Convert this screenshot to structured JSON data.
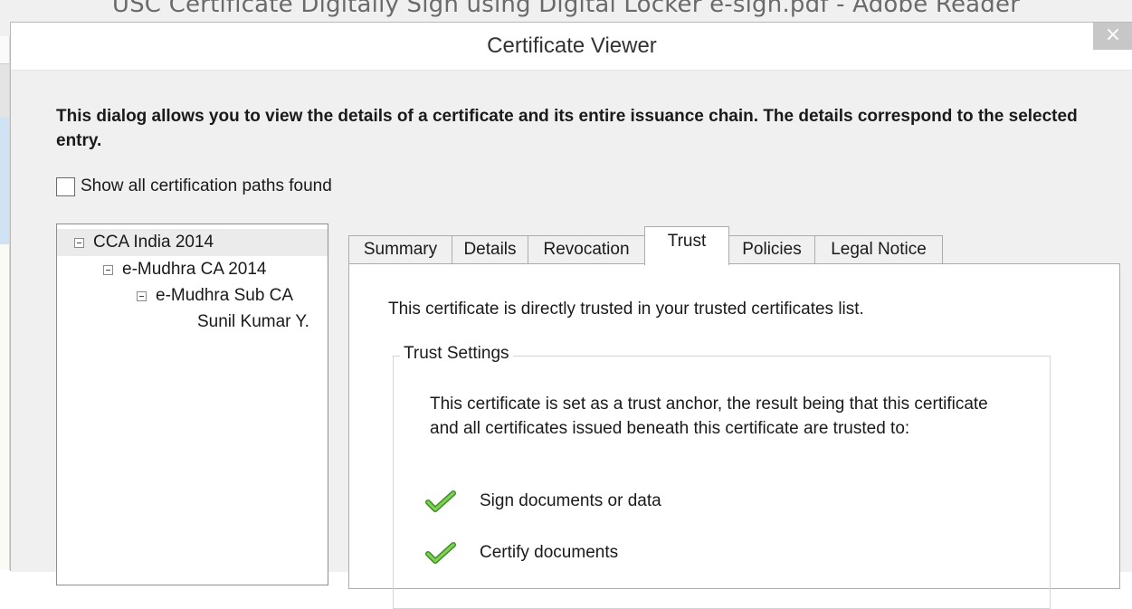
{
  "background_window": {
    "title": "USC Certificate Digitally Sign using Digital Locker e-sign.pdf - Adobe Reader"
  },
  "dialog": {
    "title": "Certificate Viewer",
    "close_label": "×",
    "intro": "This dialog allows you to view the details of a certificate and its entire issuance chain. The details correspond to the selected entry.",
    "show_paths_label": "Show all certification paths found"
  },
  "chain_tree": {
    "items": [
      {
        "label": "CCA India 2014",
        "selected": true
      },
      {
        "label": "e-Mudhra CA 2014"
      },
      {
        "label": "e-Mudhra Sub CA"
      },
      {
        "label": "Sunil Kumar Y."
      }
    ]
  },
  "tabs": [
    {
      "label": "Summary"
    },
    {
      "label": "Details"
    },
    {
      "label": "Revocation"
    },
    {
      "label": "Trust",
      "active": true
    },
    {
      "label": "Policies"
    },
    {
      "label": "Legal Notice"
    }
  ],
  "trust": {
    "direct_text": "This certificate is directly trusted in your trusted certificates list.",
    "settings_legend": "Trust Settings",
    "settings_desc": "This certificate is set as a trust anchor, the result being that this certificate and all certificates issued beneath this certificate are trusted to:",
    "items": [
      {
        "label": "Sign documents or data",
        "icon": "green-checkmark-icon"
      },
      {
        "label": "Certify documents",
        "icon": "green-checkmark-icon"
      }
    ]
  },
  "colors": {
    "check_green": "#5fb33a",
    "close_button": "#c7c7c7"
  }
}
